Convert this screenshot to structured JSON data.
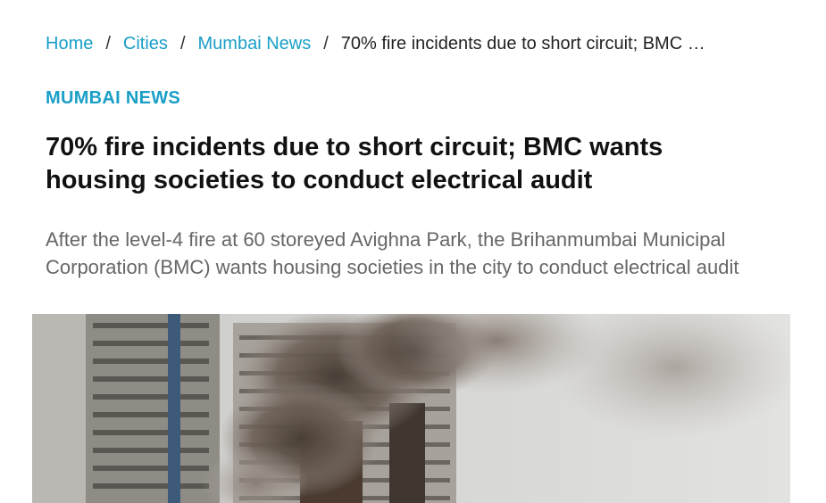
{
  "breadcrumb": {
    "items": [
      "Home",
      "Cities",
      "Mumbai News"
    ],
    "separator": "/",
    "current": "70% fire incidents due to short circuit; BMC …"
  },
  "section": {
    "label": "MUMBAI NEWS",
    "color": "#1a9fc7"
  },
  "article": {
    "headline": "70% fire incidents due to short circuit; BMC wants housing societies to conduct electrical audit",
    "summary": "After the level-4 fire at 60 storeyed Avighna Park, the Brihanmumbai Municipal Corporation (BMC) wants housing societies in the city to conduct electrical audit"
  },
  "colors": {
    "link": "#1a9fc7",
    "summary_text": "#666666",
    "headline_text": "#111111"
  }
}
